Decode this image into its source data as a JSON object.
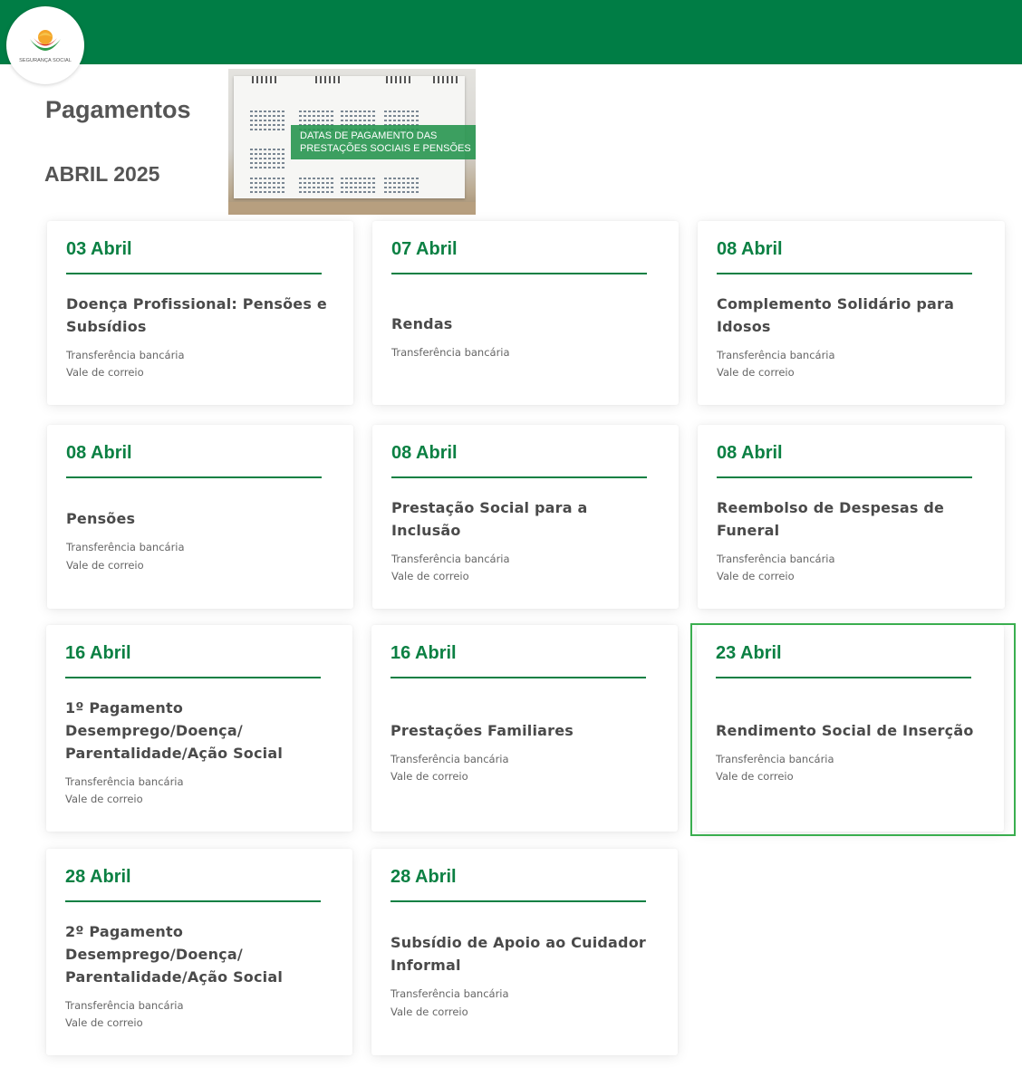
{
  "header": {
    "logo_text": "SEGURANÇA SOCIAL",
    "bar_color": "#007d45"
  },
  "page": {
    "title": "Pagamentos",
    "month": "ABRIL 2025"
  },
  "banner": {
    "text_line1": "DATAS DE PAGAMENTO DAS",
    "text_line2": "PRESTAÇÕES SOCIAIS E PENSÕES"
  },
  "accent_color": "#0b8043",
  "cards": [
    {
      "date": "03 Abril",
      "name": "Doença Profissional: Pensões e Subsídios",
      "methods": [
        "Transferência bancária",
        "Vale de correio"
      ]
    },
    {
      "date": "07 Abril",
      "name": "Rendas",
      "methods": [
        "Transferência bancária"
      ]
    },
    {
      "date": "08 Abril",
      "name": "Complemento Solidário para Idosos",
      "methods": [
        "Transferência bancária",
        "Vale de correio"
      ]
    },
    {
      "date": "08 Abril",
      "name": "Pensões",
      "methods": [
        "Transferência bancária",
        "Vale de correio"
      ]
    },
    {
      "date": "08 Abril",
      "name": "Prestação Social para a Inclusão",
      "methods": [
        "Transferência bancária",
        "Vale de correio"
      ]
    },
    {
      "date": "08 Abril",
      "name": "Reembolso de Despesas de Funeral",
      "methods": [
        "Transferência bancária",
        "Vale de correio"
      ]
    },
    {
      "date": "16 Abril",
      "name": "1º Pagamento Desemprego/Doença/ Parentalidade/Ação Social",
      "methods": [
        "Transferência bancária",
        "Vale de correio"
      ]
    },
    {
      "date": "16 Abril",
      "name": "Prestações Familiares",
      "methods": [
        "Transferência bancária",
        "Vale de correio"
      ]
    },
    {
      "date": "23 Abril",
      "name": "Rendimento Social de Inserção",
      "methods": [
        "Transferência bancária",
        "Vale de correio"
      ],
      "highlighted": true
    },
    {
      "date": "28 Abril",
      "name": "2º Pagamento Desemprego/Doença/ Parentalidade/Ação Social",
      "methods": [
        "Transferência bancária",
        "Vale de correio"
      ]
    },
    {
      "date": "28 Abril",
      "name": "Subsídio de Apoio ao Cuidador Informal",
      "methods": [
        "Transferência bancária",
        "Vale de correio"
      ]
    }
  ]
}
